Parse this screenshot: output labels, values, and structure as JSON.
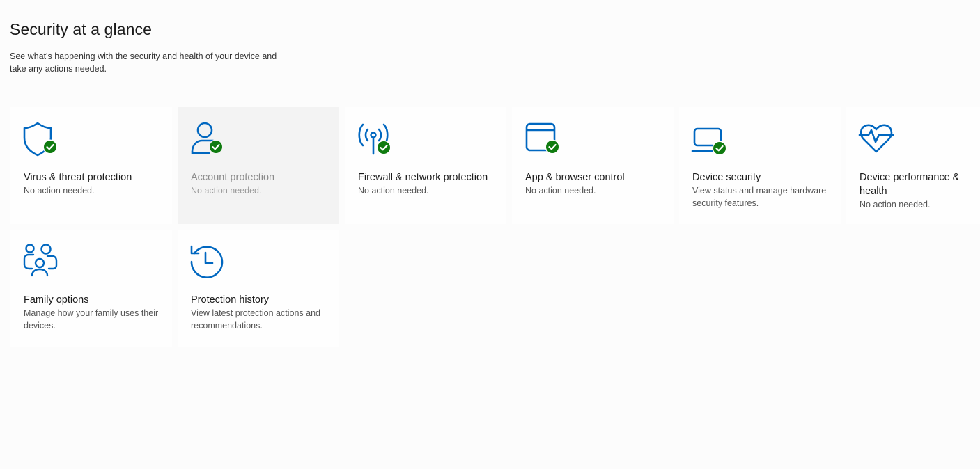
{
  "header": {
    "title": "Security at a glance",
    "subtitle": "See what's happening with the security and health of your device and take any actions needed."
  },
  "colors": {
    "accent": "#0067c0",
    "ok": "#0f7b0f",
    "hover_bg": "#f3f3f3"
  },
  "tiles": [
    {
      "title": "Virus & threat protection",
      "desc": "No action needed.",
      "icon": "shield-icon",
      "status": "ok"
    },
    {
      "title": "Account protection",
      "desc": "No action needed.",
      "icon": "person-icon",
      "status": "ok"
    },
    {
      "title": "Firewall & network protection",
      "desc": "No action needed.",
      "icon": "antenna-icon",
      "status": "ok"
    },
    {
      "title": "App & browser control",
      "desc": "No action needed.",
      "icon": "browser-window-icon",
      "status": "ok"
    },
    {
      "title": "Device security",
      "desc": "View status and manage hardware security features.",
      "icon": "laptop-icon",
      "status": "ok"
    },
    {
      "title": "Device performance & health",
      "desc": "No action needed.",
      "icon": "heart-pulse-icon",
      "status": "none"
    },
    {
      "title": "Family options",
      "desc": "Manage how your family uses their devices.",
      "icon": "family-icon",
      "status": "none"
    },
    {
      "title": "Protection history",
      "desc": "View latest protection actions and recommendations.",
      "icon": "history-clock-icon",
      "status": "none"
    }
  ]
}
